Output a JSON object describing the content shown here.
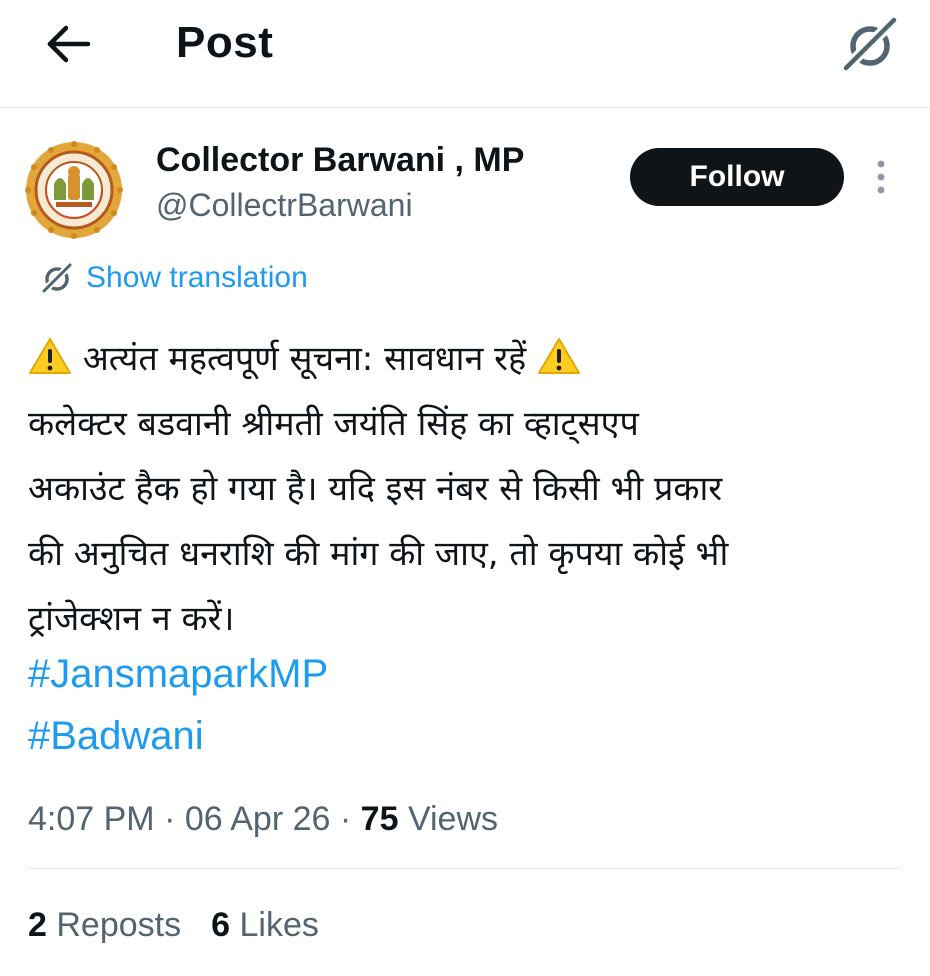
{
  "header": {
    "title": "Post",
    "back_icon": "arrow-left-icon",
    "grok_icon": "grok-icon"
  },
  "author": {
    "name": "Collector Barwani , MP",
    "handle": "@CollectrBarwani",
    "avatar_icon": "madhya-pradesh-emblem"
  },
  "follow": {
    "label": "Follow"
  },
  "more": {
    "icon": "more-vertical-icon"
  },
  "translation": {
    "label": "Show translation",
    "icon": "grok-icon"
  },
  "tweet": {
    "lines": [
      "अत्यंत महत्वपूर्ण सूचना: सावधान रहें",
      "कलेक्टर बडवानी श्रीमती जयंति सिंह का व्हाट्सएप",
      "अकाउंट हैक हो गया है। यदि इस नंबर से किसी भी प्रकार",
      "की अनुचित धनराशि की मांग की जाए, तो कृपया कोई भी",
      "ट्रांजेक्शन न करें।"
    ],
    "warning_icon": "warning-sign-emoji",
    "hashtags": [
      "#JansmaparkMP",
      "#Badwani"
    ]
  },
  "meta": {
    "time": "4:07 PM",
    "date": "06 Apr 26",
    "views_count": "75",
    "views_label": "Views",
    "separator": "·"
  },
  "stats": {
    "reposts_count": "2",
    "reposts_label": "Reposts",
    "likes_count": "6",
    "likes_label": "Likes"
  },
  "colors": {
    "accent": "#1d9bf0",
    "text": "#0f1419",
    "secondary": "#536471",
    "follow_bg": "#0f1419",
    "warning": "#ffcc22"
  }
}
